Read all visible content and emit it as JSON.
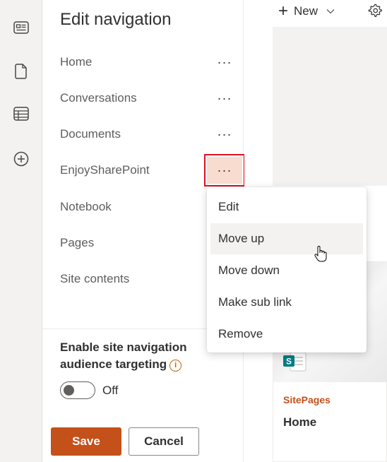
{
  "rail": {
    "icons": [
      "news-icon",
      "document-icon",
      "list-icon",
      "add-circle-icon"
    ]
  },
  "panel": {
    "title": "Edit navigation",
    "items": [
      {
        "label": "Home",
        "has_more": true
      },
      {
        "label": "Conversations",
        "has_more": true
      },
      {
        "label": "Documents",
        "has_more": true
      },
      {
        "label": "EnjoySharePoint",
        "has_more": true,
        "active": true
      },
      {
        "label": "Notebook",
        "has_more": false
      },
      {
        "label": "Pages",
        "has_more": false
      },
      {
        "label": "Site contents",
        "has_more": false
      }
    ],
    "more_glyph": "···",
    "audience_label": "Enable site navigation audience targeting",
    "info_glyph": "i",
    "toggle_state": "Off",
    "save_label": "Save",
    "cancel_label": "Cancel"
  },
  "context_menu": {
    "items": [
      "Edit",
      "Move up",
      "Move down",
      "Make sub link",
      "Remove"
    ],
    "hovered": "Move up"
  },
  "command_bar": {
    "new_label": "New",
    "plus_glyph": "+",
    "chevron_glyph": "⌵"
  },
  "card": {
    "category": "SitePages",
    "title": "Home",
    "accent_color": "#c4501a"
  },
  "colors": {
    "accent": "#c4501a",
    "highlight_outline": "#e01020",
    "active_bg": "#f8dcd0"
  }
}
